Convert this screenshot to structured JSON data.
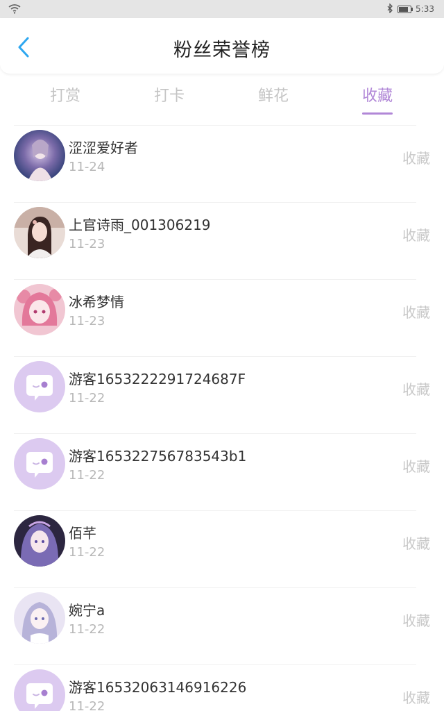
{
  "status_bar": {
    "time": "5:33",
    "icons": [
      "wifi-icon",
      "bluetooth-icon",
      "battery-icon"
    ]
  },
  "header": {
    "title": "粉丝荣誉榜",
    "back_icon": "chevron-left-icon"
  },
  "tabs": [
    {
      "label": "打赏",
      "active": false
    },
    {
      "label": "打卡",
      "active": false
    },
    {
      "label": "鲜花",
      "active": false
    },
    {
      "label": "收藏",
      "active": true
    }
  ],
  "list": [
    {
      "name": "涩涩爱好者",
      "date": "11-24",
      "action": "收藏",
      "avatar": "anime-avatar"
    },
    {
      "name": "上官诗雨_001306219",
      "date": "11-23",
      "action": "收藏",
      "avatar": "photo-avatar"
    },
    {
      "name": "冰希梦情",
      "date": "11-23",
      "action": "收藏",
      "avatar": "pink-anime-avatar"
    },
    {
      "name": "游客1653222291724687F",
      "date": "11-22",
      "action": "收藏",
      "avatar": "default-avatar"
    },
    {
      "name": "游客165322756783543b1",
      "date": "11-22",
      "action": "收藏",
      "avatar": "default-avatar"
    },
    {
      "name": "佰芊",
      "date": "11-22",
      "action": "收藏",
      "avatar": "anime-girl-avatar"
    },
    {
      "name": "婉宁a",
      "date": "11-22",
      "action": "收藏",
      "avatar": "anime-girl-avatar"
    },
    {
      "name": "游客16532063146916226",
      "date": "11-22",
      "action": "收藏",
      "avatar": "default-avatar"
    }
  ],
  "colors": {
    "accent": "#b187d7",
    "tab_inactive": "#c4c4c4",
    "text": "#333333",
    "subtext": "#b7b7b7",
    "back_arrow": "#2ea7f0"
  }
}
